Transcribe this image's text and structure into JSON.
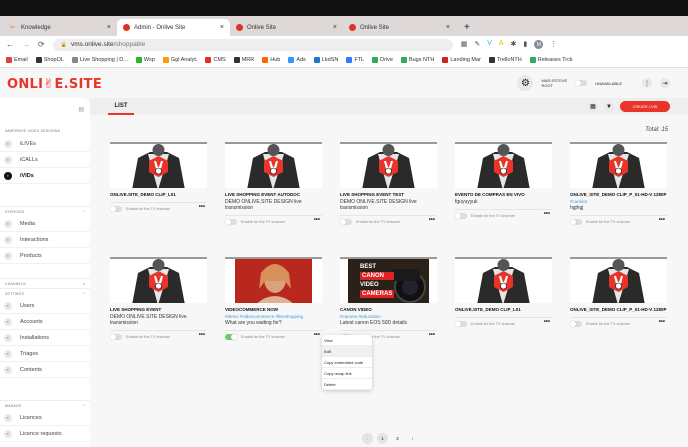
{
  "browser": {
    "tabs": [
      {
        "title": "Knowledge",
        "active": false
      },
      {
        "title": "Admin - Onlive Site",
        "active": true
      },
      {
        "title": "Onlive Site",
        "active": false
      },
      {
        "title": "Onlive Site",
        "active": false
      }
    ],
    "url_host": "vms.onlive.site",
    "url_path": "/shoppable",
    "bookmarks": [
      {
        "label": "Email",
        "color": "#d44"
      },
      {
        "label": "ShopOL",
        "color": "#333"
      },
      {
        "label": "Live Shopping | D...",
        "color": "#888"
      },
      {
        "label": "Wsp",
        "color": "#2b2"
      },
      {
        "label": "Ggl Analyt.",
        "color": "#f90"
      },
      {
        "label": "CMS",
        "color": "#d32"
      },
      {
        "label": "MRR",
        "color": "#333"
      },
      {
        "label": "Hub",
        "color": "#f60"
      },
      {
        "label": "Ads",
        "color": "#39f"
      },
      {
        "label": "LkdSN",
        "color": "#27c"
      },
      {
        "label": "FTL",
        "color": "#37f"
      },
      {
        "label": "Drive",
        "color": "#3a5"
      },
      {
        "label": "Bugs NTH",
        "color": "#3a5"
      },
      {
        "label": "Landing Mar",
        "color": "#c22"
      },
      {
        "label": "TrelloNTH",
        "color": "#333"
      },
      {
        "label": "Releases Trck",
        "color": "#3a5"
      }
    ]
  },
  "header": {
    "logo": "ONLI✌E.SITE",
    "user_name": "MAR ESTEVE",
    "user_role": "ROOT",
    "availability": "UNAVAILABLE"
  },
  "sidebar": {
    "sections": [
      {
        "title": "IMMERSIVE VIDEO SESSIONS",
        "chevron": "",
        "items": [
          {
            "label": "iLIVEs",
            "icon": "camera-icon"
          },
          {
            "label": "iCALLs",
            "icon": "call-icon"
          },
          {
            "label": "iVIDs",
            "icon": "video-icon",
            "active": true
          }
        ]
      },
      {
        "title": "STEROIDS",
        "chevron": "^",
        "items": [
          {
            "label": "Media",
            "icon": "media-icon"
          },
          {
            "label": "Interactions",
            "icon": "interactions-icon"
          },
          {
            "label": "Products",
            "icon": "cart-icon"
          }
        ]
      },
      {
        "title": "CHANNELS",
        "chevron": "v",
        "items": []
      },
      {
        "title": "SETTINGS",
        "chevron": "^",
        "items": [
          {
            "label": "Users",
            "icon": "users-icon"
          },
          {
            "label": "Accounts",
            "icon": "accounts-icon"
          },
          {
            "label": "Installations",
            "icon": "installations-icon"
          },
          {
            "label": "Triages",
            "icon": "triages-icon"
          },
          {
            "label": "Contents",
            "icon": "contents-icon"
          }
        ]
      },
      {
        "title": "MANAGE",
        "chevron": "^",
        "items": [
          {
            "label": "Licences",
            "icon": "key-icon"
          },
          {
            "label": "Licence requests",
            "icon": "request-icon"
          }
        ]
      }
    ]
  },
  "main": {
    "tab": "LIST",
    "create_label": "CREATE I-VID",
    "total": "Total: 15",
    "toggle_label": "Enable for the TV channel",
    "cards": [
      {
        "title": "ONLIVE.SITE_DEMO CLIP_L01",
        "tags": "",
        "desc": "",
        "thumb": "logo",
        "tv": false
      },
      {
        "title": "LIVE SHOPPING EVENT AUTODOC",
        "tags": "",
        "desc": "DEMO ONLIVE.SITE DESIGN live transmission",
        "thumb": "logo",
        "tv": false
      },
      {
        "title": "LIVE SHOPPING EVENT TEST",
        "tags": "",
        "desc": "DEMO ONLIVE.SITE DESIGN live transmission",
        "thumb": "logo",
        "tv": false
      },
      {
        "title": "EVENTO DE COMPRAS EN VIVO",
        "tags": "",
        "desc": "fguyuyyuk",
        "thumb": "logo",
        "tv": false
      },
      {
        "title": "ONLIVE_SITE_DEMO CLIP_P_01-HD-V 1280P",
        "tags": "#camera",
        "desc": "hgjhgj",
        "thumb": "logo",
        "tv": false
      },
      {
        "title": "LIVE SHOPPING EVENT",
        "tags": "",
        "desc": "DEMO ONLIVE.SITE DESIGN live transmission",
        "thumb": "logo",
        "tv": false
      },
      {
        "title": "VIDEOCOMMERCE NOW",
        "tags": "#demo #videocommerce #liveshopping",
        "desc": "What are you waiting for?",
        "thumb": "person",
        "tv": true
      },
      {
        "title": "CANON VIDEO",
        "tags": "#camera #education",
        "desc": "Latest canon EOS 50D details",
        "thumb": "camera",
        "thumb_text": [
          "BEST",
          "CANON",
          "VIDEO",
          "CAMERAS"
        ],
        "tv": false
      },
      {
        "title": "ONLIVE.SITE_DEMO CLIP_L01",
        "tags": "",
        "desc": "",
        "thumb": "logo",
        "tv": false
      },
      {
        "title": "ONLIVE_SITE_DEMO CLIP_P_01-HD-V 1280P",
        "tags": "",
        "desc": "",
        "thumb": "logo",
        "tv": false
      }
    ],
    "context_menu": [
      "View",
      "Edit",
      "Copy embedded code",
      "Copy recap link",
      "Delete"
    ],
    "pagination": {
      "prev": "‹",
      "pages": [
        "1",
        "2"
      ],
      "current": "1",
      "next": "›"
    }
  },
  "colors": {
    "brand": "#e8342a",
    "tag": "#3b9de0",
    "toggle_on": "#6ccc6c"
  }
}
